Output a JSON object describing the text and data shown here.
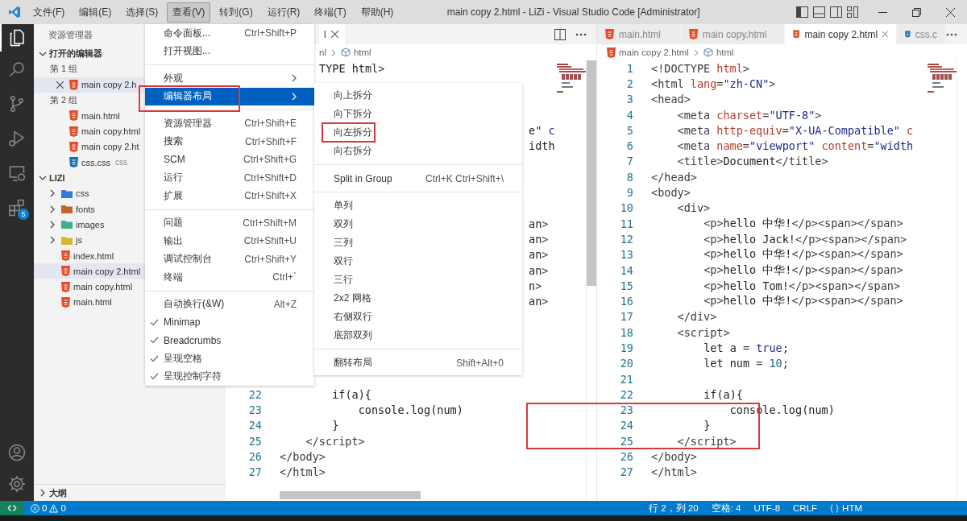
{
  "title_bar": {
    "menus": [
      {
        "label": "文件(F)",
        "selected": false
      },
      {
        "label": "编辑(E)",
        "selected": false
      },
      {
        "label": "选择(S)",
        "selected": false
      },
      {
        "label": "查看(V)",
        "selected": true
      },
      {
        "label": "转到(G)",
        "selected": false
      },
      {
        "label": "运行(R)",
        "selected": false
      },
      {
        "label": "终端(T)",
        "selected": false
      },
      {
        "label": "帮助(H)",
        "selected": false
      }
    ],
    "title": "main copy 2.html - LiZi - Visual Studio Code [Administrator]"
  },
  "activity_bar": {
    "items": [
      {
        "kind": "explorer",
        "selected": true
      },
      {
        "kind": "search",
        "selected": false
      },
      {
        "kind": "source-control",
        "selected": false
      },
      {
        "kind": "run",
        "selected": false
      },
      {
        "kind": "remote",
        "selected": false
      },
      {
        "kind": "extensions",
        "selected": false,
        "badge": "5"
      }
    ],
    "bottom": [
      {
        "kind": "account"
      },
      {
        "kind": "settings"
      }
    ]
  },
  "sidebar": {
    "title": "资源管理器",
    "open_editors": {
      "label": "打开的编辑器",
      "expanded": true,
      "groups": [
        {
          "label": "第 1 组",
          "files": [
            {
              "name": "main copy 2.h",
              "kind": "html",
              "selected": true
            }
          ]
        },
        {
          "label": "第 2 组",
          "files": [
            {
              "name": "main.html",
              "kind": "html",
              "selected": false
            },
            {
              "name": "main copy.html",
              "kind": "html",
              "selected": false
            },
            {
              "name": "main copy 2.ht",
              "kind": "html",
              "selected": false
            },
            {
              "name": "css.css",
              "kind": "css",
              "folder": "css",
              "selected": false
            }
          ]
        }
      ]
    },
    "folder": {
      "label": "LIZI",
      "expanded": true,
      "items": [
        {
          "kind": "folder",
          "name": "css",
          "color": "#2f7bd6",
          "expanded": false
        },
        {
          "kind": "folder",
          "name": "fonts",
          "color": "#c2652a",
          "expanded": false
        },
        {
          "kind": "folder",
          "name": "images",
          "color": "#3fae8a",
          "expanded": false
        },
        {
          "kind": "folder",
          "name": "js",
          "color": "#d9b72e",
          "expanded": false
        },
        {
          "kind": "html",
          "name": "index.html",
          "selected": false
        },
        {
          "kind": "html",
          "name": "main copy 2.html",
          "selected": true
        },
        {
          "kind": "html",
          "name": "main copy.html",
          "selected": false
        },
        {
          "kind": "html",
          "name": "main.html",
          "selected": false
        }
      ]
    },
    "outline": {
      "label": "大纲",
      "expanded": false
    }
  },
  "editor_left": {
    "tabs": [
      {
        "label": "l",
        "selected": true
      }
    ],
    "breadcrumb": [
      {
        "label": "nl",
        "kind": "plain"
      },
      {
        "label": "html",
        "kind": "element"
      }
    ],
    "lines": [
      {
        "kind": "cut",
        "code": "TYPE html>"
      },
      {
        "kind": "covered"
      },
      {
        "kind": "covered"
      },
      {
        "kind": "covered"
      },
      {
        "kind": "tail",
        "code": "e\" c"
      },
      {
        "kind": "tail",
        "code": "idth"
      },
      {
        "kind": "covered"
      },
      {
        "kind": "covered"
      },
      {
        "kind": "covered"
      },
      {
        "kind": "covered"
      },
      {
        "kind": "tail",
        "code": "an>"
      },
      {
        "kind": "tail",
        "code": "an>"
      },
      {
        "kind": "tail",
        "code": "an>"
      },
      {
        "kind": "tail",
        "code": "an>"
      },
      {
        "kind": "tail",
        "code": "n>"
      },
      {
        "kind": "tail",
        "code": "an>"
      },
      {
        "kind": "covered"
      },
      {
        "kind": "covered"
      },
      {
        "kind": "covered"
      },
      {
        "kind": "covered"
      },
      {
        "kind": "covered"
      },
      {
        "kind": "full",
        "number": "22",
        "code": "        if(a){"
      },
      {
        "kind": "full",
        "number": "23",
        "code": "            console.log(num)"
      },
      {
        "kind": "full",
        "number": "24",
        "code": "        }"
      },
      {
        "kind": "full",
        "number": "25",
        "code": "    </script>"
      },
      {
        "kind": "full",
        "number": "26",
        "code": "</body>"
      },
      {
        "kind": "full",
        "number": "27",
        "code": "</html>"
      }
    ]
  },
  "editor_right": {
    "tabs": [
      {
        "label": "main.html",
        "kind": "html",
        "selected": false
      },
      {
        "label": "main copy.html",
        "kind": "html",
        "selected": false
      },
      {
        "label": "main copy 2.html",
        "kind": "html",
        "selected": true
      },
      {
        "label": "css.c",
        "kind": "css",
        "selected": false
      }
    ],
    "breadcrumb": [
      {
        "label": "main copy 2.html",
        "kind": "html"
      },
      {
        "label": "html",
        "kind": "element"
      }
    ],
    "lines": [
      {
        "kind": "full",
        "number": "1",
        "code": "<!DOCTYPE html>"
      },
      {
        "kind": "full",
        "number": "2",
        "code": "<html lang=\"zh-CN\">"
      },
      {
        "kind": "full",
        "number": "3",
        "code": "<head>"
      },
      {
        "kind": "full",
        "number": "4",
        "code": "    <meta charset=\"UTF-8\">"
      },
      {
        "kind": "full",
        "number": "5",
        "code": "    <meta http-equiv=\"X-UA-Compatible\" c"
      },
      {
        "kind": "full",
        "number": "6",
        "code": "    <meta name=\"viewport\" content=\"width"
      },
      {
        "kind": "full",
        "number": "7",
        "code": "    <title>Document</title>"
      },
      {
        "kind": "full",
        "number": "8",
        "code": "</head>"
      },
      {
        "kind": "full",
        "number": "9",
        "code": "<body>"
      },
      {
        "kind": "full",
        "number": "10",
        "code": "    <div>"
      },
      {
        "kind": "full",
        "number": "11",
        "code": "        <p>hello 中华!</p><span></span>"
      },
      {
        "kind": "full",
        "number": "12",
        "code": "        <p>hello Jack!</p><span></span>"
      },
      {
        "kind": "full",
        "number": "13",
        "code": "        <p>hello 中华!</p><span></span>"
      },
      {
        "kind": "full",
        "number": "14",
        "code": "        <p>hello 中华!</p><span></span>"
      },
      {
        "kind": "full",
        "number": "15",
        "code": "        <p>hello Tom!</p><span></span>"
      },
      {
        "kind": "full",
        "number": "16",
        "code": "        <p>hello 中华!</p><span></span>"
      },
      {
        "kind": "full",
        "number": "17",
        "code": "    </div>"
      },
      {
        "kind": "full",
        "number": "18",
        "code": "    <script>"
      },
      {
        "kind": "full",
        "number": "19",
        "code": "        let a = true;"
      },
      {
        "kind": "full",
        "number": "20",
        "code": "        let num = 10;"
      },
      {
        "kind": "full",
        "number": "21"
      },
      {
        "kind": "full",
        "number": "22",
        "code": "        if(a){"
      },
      {
        "kind": "full",
        "number": "23",
        "code": "            console.log(num)"
      },
      {
        "kind": "full",
        "number": "24",
        "code": "        }"
      },
      {
        "kind": "full",
        "number": "25",
        "code": "    </script>"
      },
      {
        "kind": "full",
        "number": "26",
        "code": "</body>"
      },
      {
        "kind": "full",
        "number": "27",
        "code": "</html>"
      }
    ]
  },
  "view_menu": {
    "items": [
      {
        "kind": "command",
        "label": "命令面板...",
        "shortcut": "Ctrl+Shift+P",
        "selected": false
      },
      {
        "kind": "command",
        "label": "打开视图...",
        "selected": false
      },
      {
        "kind": "separator"
      },
      {
        "kind": "submenu",
        "label": "外观",
        "selected": false
      },
      {
        "kind": "submenu",
        "label": "编辑器布局",
        "selected": true
      },
      {
        "kind": "separator"
      },
      {
        "kind": "command",
        "label": "资源管理器",
        "shortcut": "Ctrl+Shift+E",
        "selected": false
      },
      {
        "kind": "command",
        "label": "搜索",
        "shortcut": "Ctrl+Shift+F",
        "selected": false
      },
      {
        "kind": "command",
        "label": "SCM",
        "shortcut": "Ctrl+Shift+G",
        "selected": false
      },
      {
        "kind": "command",
        "label": "运行",
        "shortcut": "Ctrl+Shift+D",
        "selected": false
      },
      {
        "kind": "command",
        "label": "扩展",
        "shortcut": "Ctrl+Shift+X",
        "selected": false
      },
      {
        "kind": "separator"
      },
      {
        "kind": "command",
        "label": "问题",
        "shortcut": "Ctrl+Shift+M",
        "selected": false
      },
      {
        "kind": "command",
        "label": "输出",
        "shortcut": "Ctrl+Shift+U",
        "selected": false
      },
      {
        "kind": "command",
        "label": "调试控制台",
        "shortcut": "Ctrl+Shift+Y",
        "selected": false
      },
      {
        "kind": "command",
        "label": "终端",
        "shortcut": "Ctrl+`",
        "selected": false
      },
      {
        "kind": "separator"
      },
      {
        "kind": "toggle",
        "label": "自动换行(&W)",
        "shortcut": "Alt+Z",
        "checked": false,
        "selected": false
      },
      {
        "kind": "toggle",
        "label": "Minimap",
        "checked": true,
        "selected": false
      },
      {
        "kind": "toggle",
        "label": "Breadcrumbs",
        "checked": true,
        "selected": false
      },
      {
        "kind": "toggle",
        "label": "呈现空格",
        "checked": true,
        "selected": false
      },
      {
        "kind": "toggle",
        "label": "呈现控制字符",
        "checked": true,
        "selected": false
      }
    ]
  },
  "layout_submenu": {
    "items": [
      {
        "kind": "command",
        "label": "向上拆分"
      },
      {
        "kind": "command",
        "label": "向下拆分"
      },
      {
        "kind": "command",
        "label": "向左拆分"
      },
      {
        "kind": "command",
        "label": "向右拆分"
      },
      {
        "kind": "separator"
      },
      {
        "kind": "command",
        "label": "Split in Group",
        "shortcut": "Ctrl+K Ctrl+Shift+\\"
      },
      {
        "kind": "separator"
      },
      {
        "kind": "command",
        "label": "单列"
      },
      {
        "kind": "command",
        "label": "双列"
      },
      {
        "kind": "command",
        "label": "三列"
      },
      {
        "kind": "command",
        "label": "双行"
      },
      {
        "kind": "command",
        "label": "三行"
      },
      {
        "kind": "command",
        "label": "2x2 网格"
      },
      {
        "kind": "command",
        "label": "右侧双行"
      },
      {
        "kind": "command",
        "label": "底部双列"
      },
      {
        "kind": "separator"
      },
      {
        "kind": "command",
        "label": "翻转布局",
        "shortcut": "Shift+Alt+0"
      }
    ]
  },
  "status_bar": {
    "errors": "0",
    "warnings": "0",
    "items": [
      {
        "kind": "text",
        "text": "行 2，列 20"
      },
      {
        "kind": "text",
        "text": "空格: 4"
      },
      {
        "kind": "text",
        "text": "UTF-8"
      },
      {
        "kind": "text",
        "text": "CRLF"
      },
      {
        "kind": "language",
        "text": "HTM"
      }
    ]
  }
}
